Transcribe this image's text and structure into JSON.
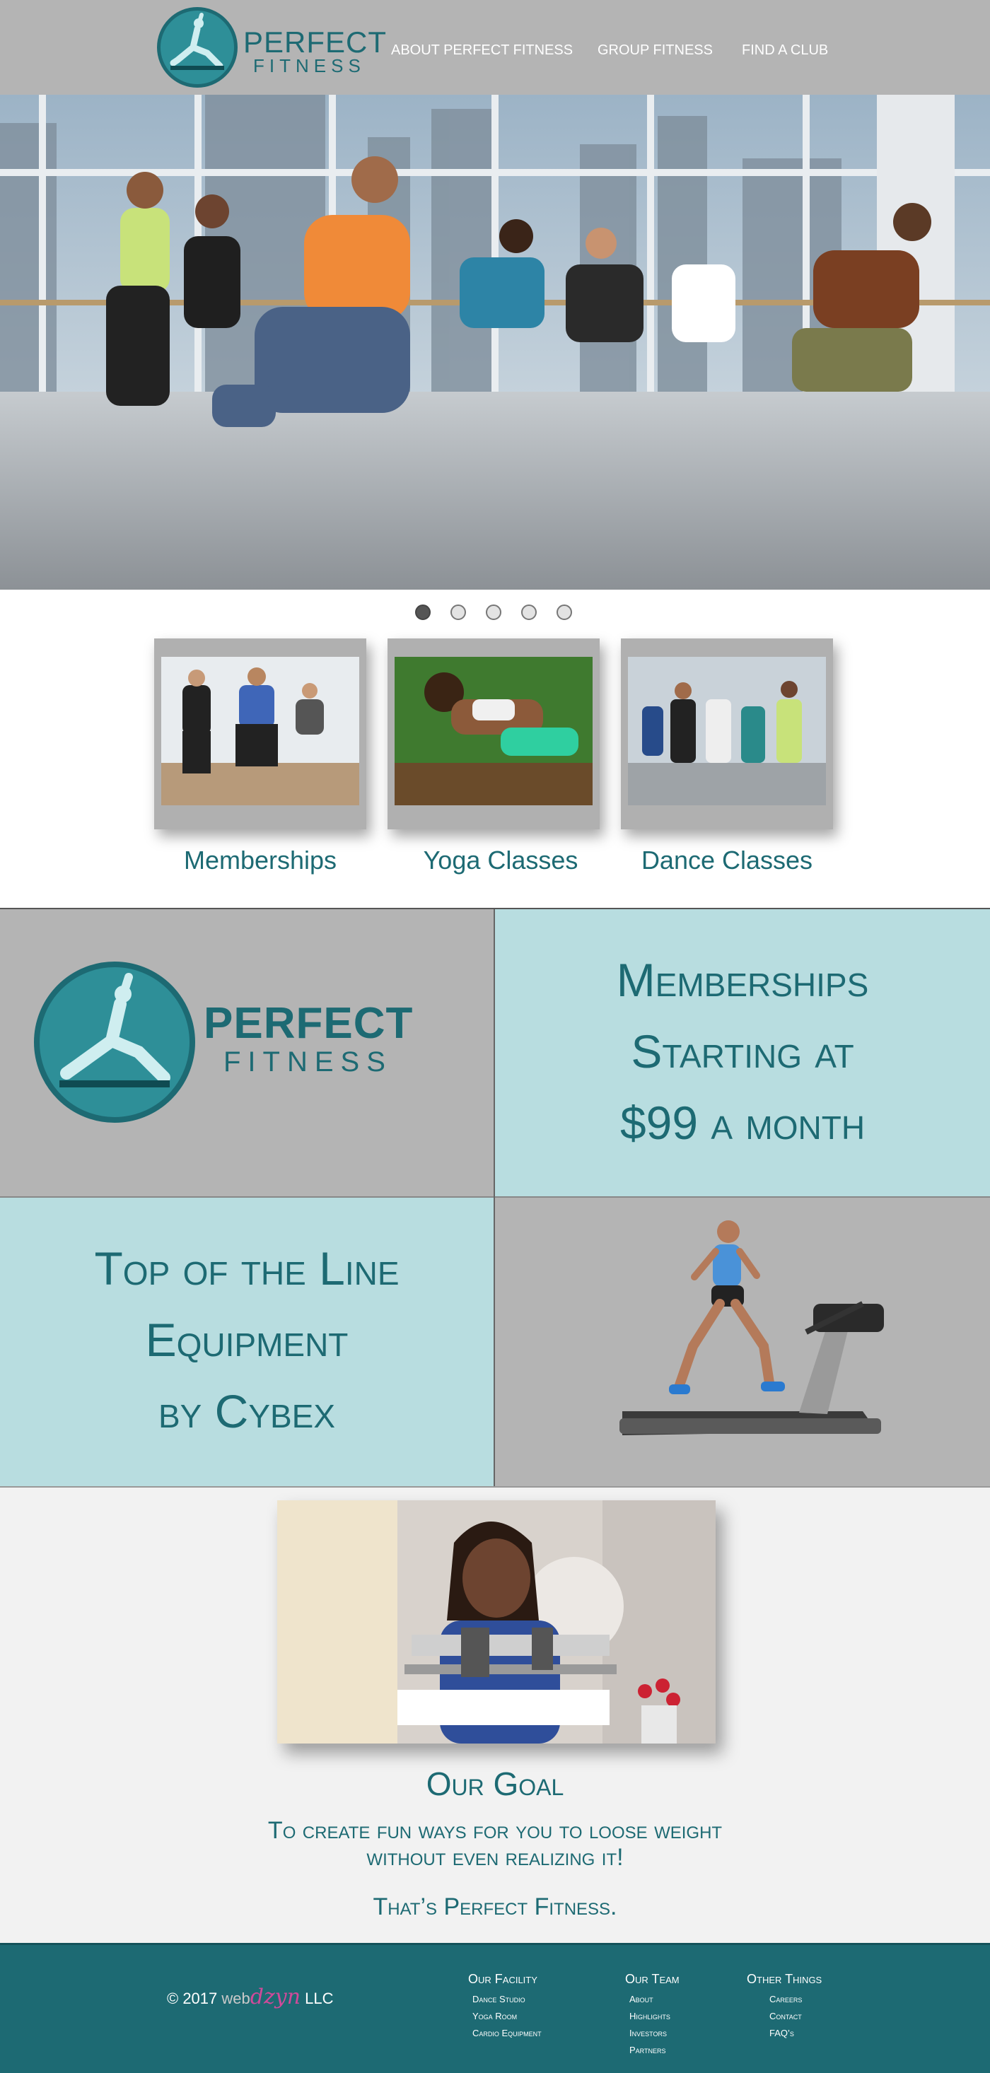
{
  "brand": {
    "name_line1": "PERFECT",
    "name_line2": "FITNESS"
  },
  "nav": {
    "items": [
      "ABOUT PERFECT FITNESS",
      "GROUP FITNESS",
      "FIND A CLUB"
    ]
  },
  "slider": {
    "slide_count": 5,
    "active_index": 0
  },
  "cards": [
    {
      "label": "Memberships"
    },
    {
      "label": "Yoga Classes"
    },
    {
      "label": "Dance Classes"
    }
  ],
  "promo": {
    "memberships": [
      "Memberships",
      "Starting at",
      "$99 a month"
    ],
    "equipment": [
      "Top of the Line",
      "Equipment",
      "by Cybex"
    ]
  },
  "goal": {
    "title": "Our Goal",
    "line1": "To create fun ways for you to loose weight",
    "line2": "without even realizing it!",
    "tagline": "That’s Perfect Fitness."
  },
  "footer": {
    "copyright_prefix": "© 2017",
    "brand_a": "web",
    "brand_b": "dzyn",
    "brand_suffix": "LLC",
    "columns": [
      {
        "title": "Our Facility",
        "links": [
          "Dance Studio",
          "Yoga Room",
          "Cardio Equipment"
        ]
      },
      {
        "title": "Our Team",
        "links": [
          "About",
          "Highlights",
          "Investors",
          "Partners"
        ]
      },
      {
        "title": "Other Things",
        "links": [
          "Careers",
          "Contact",
          "FAQ’s"
        ]
      }
    ]
  },
  "colors": {
    "primary_teal": "#1d6a73",
    "logo_teal": "#2e8f98",
    "light_teal": "#b8dde0",
    "header_gray": "#b4b4b4"
  }
}
